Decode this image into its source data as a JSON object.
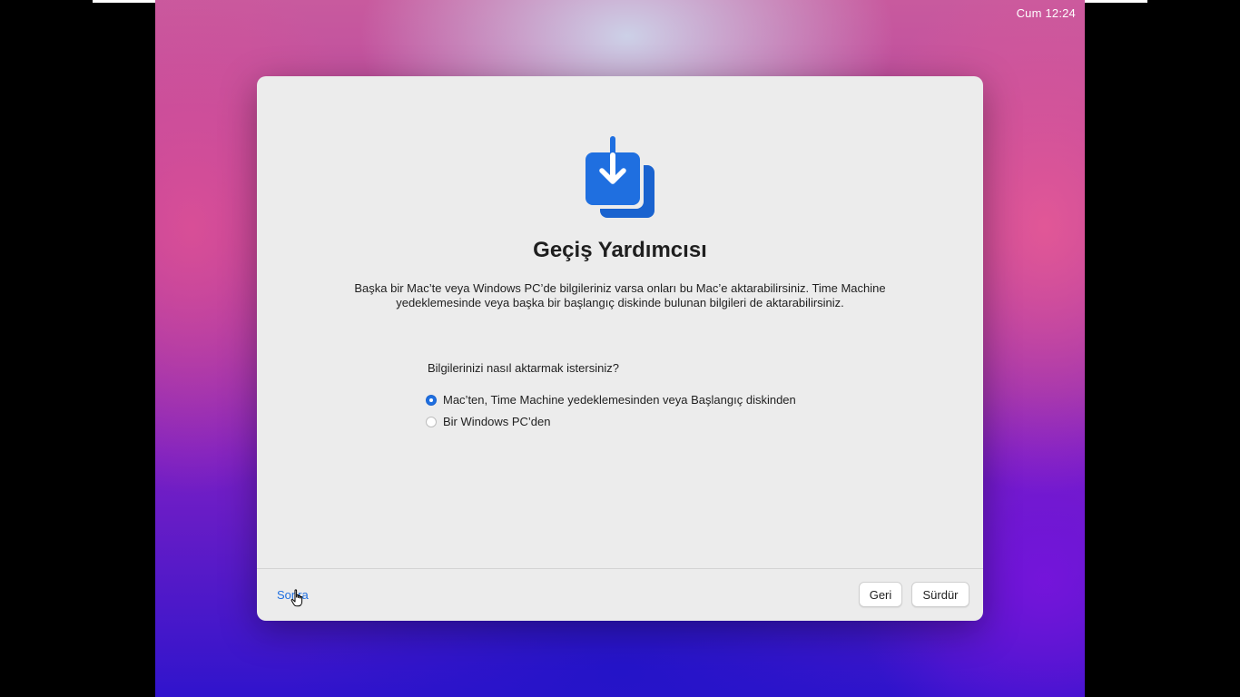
{
  "menubar": {
    "clock": "Cum 12:24"
  },
  "dialog": {
    "icon": "migration-download-icon",
    "title": "Geçiş Yardımcısı",
    "description_line1": "Başka bir Mac’te veya Windows PC’de bilgileriniz varsa onları bu Mac’e aktarabilirsiniz. Time Machine",
    "description_line2": "yedeklemesinde veya başka bir başlangıç diskinde bulunan bilgileri de aktarabilirsiniz.",
    "question": "Bilgilerinizi nasıl aktarmak istersiniz?",
    "options": [
      {
        "label": "Mac’ten, Time Machine yedeklemesinden veya Başlangıç diskinden",
        "selected": true
      },
      {
        "label": "Bir Windows PC’den",
        "selected": false
      }
    ],
    "footer": {
      "later_link": "Sonra",
      "back_button": "Geri",
      "continue_button": "Sürdür"
    }
  },
  "colors": {
    "accent": "#1f6fe0",
    "dialog_background": "#ececec",
    "text": "#1f1f1f"
  }
}
